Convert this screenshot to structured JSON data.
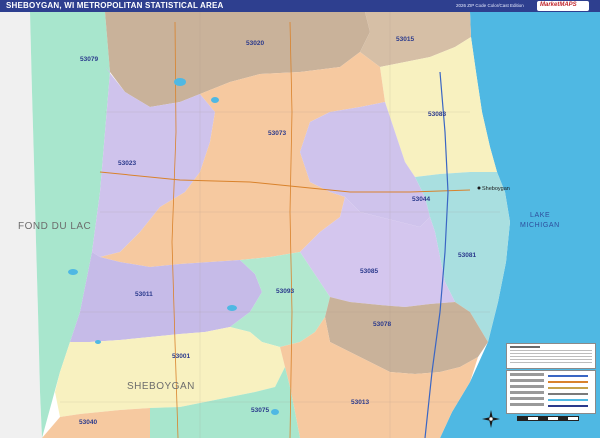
{
  "header": {
    "title": "SHEBOYGAN, WI METROPOLITAN STATISTICAL AREA",
    "edition": "2026 ZIP Code Color/Cast Edition"
  },
  "logo": {
    "name": "MarketMAPS"
  },
  "zip_codes": [
    "53020",
    "53015",
    "53079",
    "53073",
    "53083",
    "53023",
    "53044",
    "53081",
    "53085",
    "53011",
    "53093",
    "53078",
    "53001",
    "53013",
    "53075",
    "53040"
  ],
  "labels": {
    "zip_53020": "53020",
    "zip_53015": "53015",
    "zip_53079": "53079",
    "zip_53073": "53073",
    "zip_53083": "53083",
    "zip_53023": "53023",
    "zip_53044": "53044",
    "zip_53081": "53081",
    "zip_53085": "53085",
    "zip_53011": "53011",
    "zip_53093": "53093",
    "zip_53078": "53078",
    "zip_53001": "53001",
    "zip_53013": "53013",
    "zip_53075": "53075",
    "zip_53040": "53040",
    "county_fond_du_lac": "FOND DU LAC",
    "county_sheboygan": "SHEBOYGAN",
    "lake_line1": "LAKE",
    "lake_line2": "MICHIGAN",
    "city_sheboygan": "Sheboygan"
  },
  "colors": {
    "lake": "#4fb8e3",
    "outside_area": "#f2f2f2",
    "violet": "#cfc3ec",
    "peach": "#f6c9a0",
    "tan": "#c9b29a",
    "mint": "#b2e8cf",
    "cream": "#f8f1c0",
    "teal": "#a9dfe0",
    "title_bar": "#2e3f8f"
  },
  "icons": {
    "compass": "compass-rose-icon",
    "logo": "market-maps-logo"
  }
}
